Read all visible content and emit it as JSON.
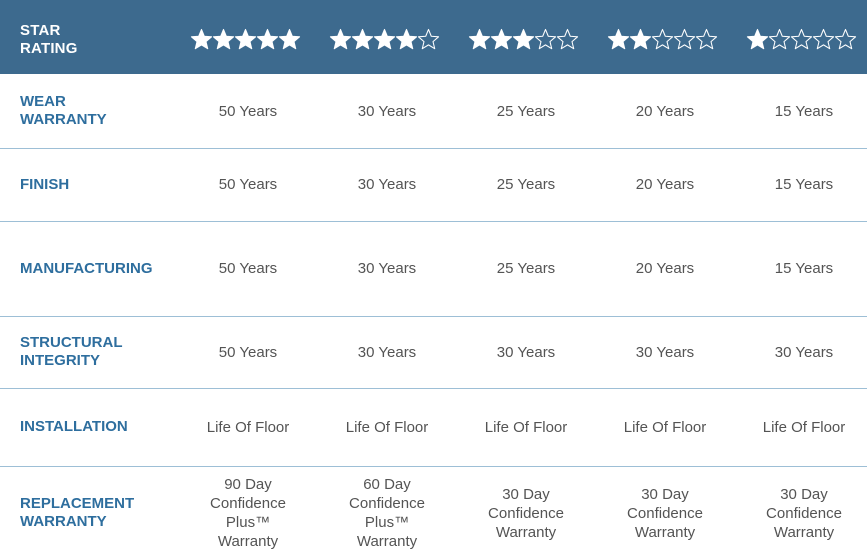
{
  "header": {
    "label": "STAR\nRATING",
    "ratings": [
      5,
      4,
      3,
      2,
      1
    ],
    "max_stars": 5
  },
  "rows": [
    {
      "label": "WEAR\nWARRANTY",
      "values": [
        "50 Years",
        "30 Years",
        "25 Years",
        "20 Years",
        "15 Years"
      ]
    },
    {
      "label": "FINISH",
      "values": [
        "50 Years",
        "30 Years",
        "25 Years",
        "20 Years",
        "15 Years"
      ]
    },
    {
      "label": "MANUFACTURING",
      "values": [
        "50 Years",
        "30 Years",
        "25 Years",
        "20 Years",
        "15 Years"
      ]
    },
    {
      "label": "STRUCTURAL\nINTEGRITY",
      "values": [
        "50 Years",
        "30 Years",
        "30 Years",
        "30 Years",
        "30 Years"
      ]
    },
    {
      "label": "INSTALLATION",
      "values": [
        "Life Of Floor",
        "Life Of Floor",
        "Life Of Floor",
        "Life Of Floor",
        "Life Of Floor"
      ]
    },
    {
      "label": "REPLACEMENT\nWARRANTY",
      "values": [
        "90 Day\nConfidence\nPlus™\nWarranty",
        "60 Day\nConfidence\nPlus™\nWarranty",
        "30 Day\nConfidence\nWarranty",
        "30 Day\nConfidence\nWarranty",
        "30 Day\nConfidence\nWarranty"
      ]
    }
  ],
  "colors": {
    "header_bg": "#3d6a8e",
    "label_text": "#2e6e9e",
    "cell_text": "#545454",
    "divider": "#9dbfd6",
    "star": "#ffffff"
  },
  "icons": {
    "filled_star": "star-filled-icon",
    "empty_star": "star-outline-icon"
  }
}
